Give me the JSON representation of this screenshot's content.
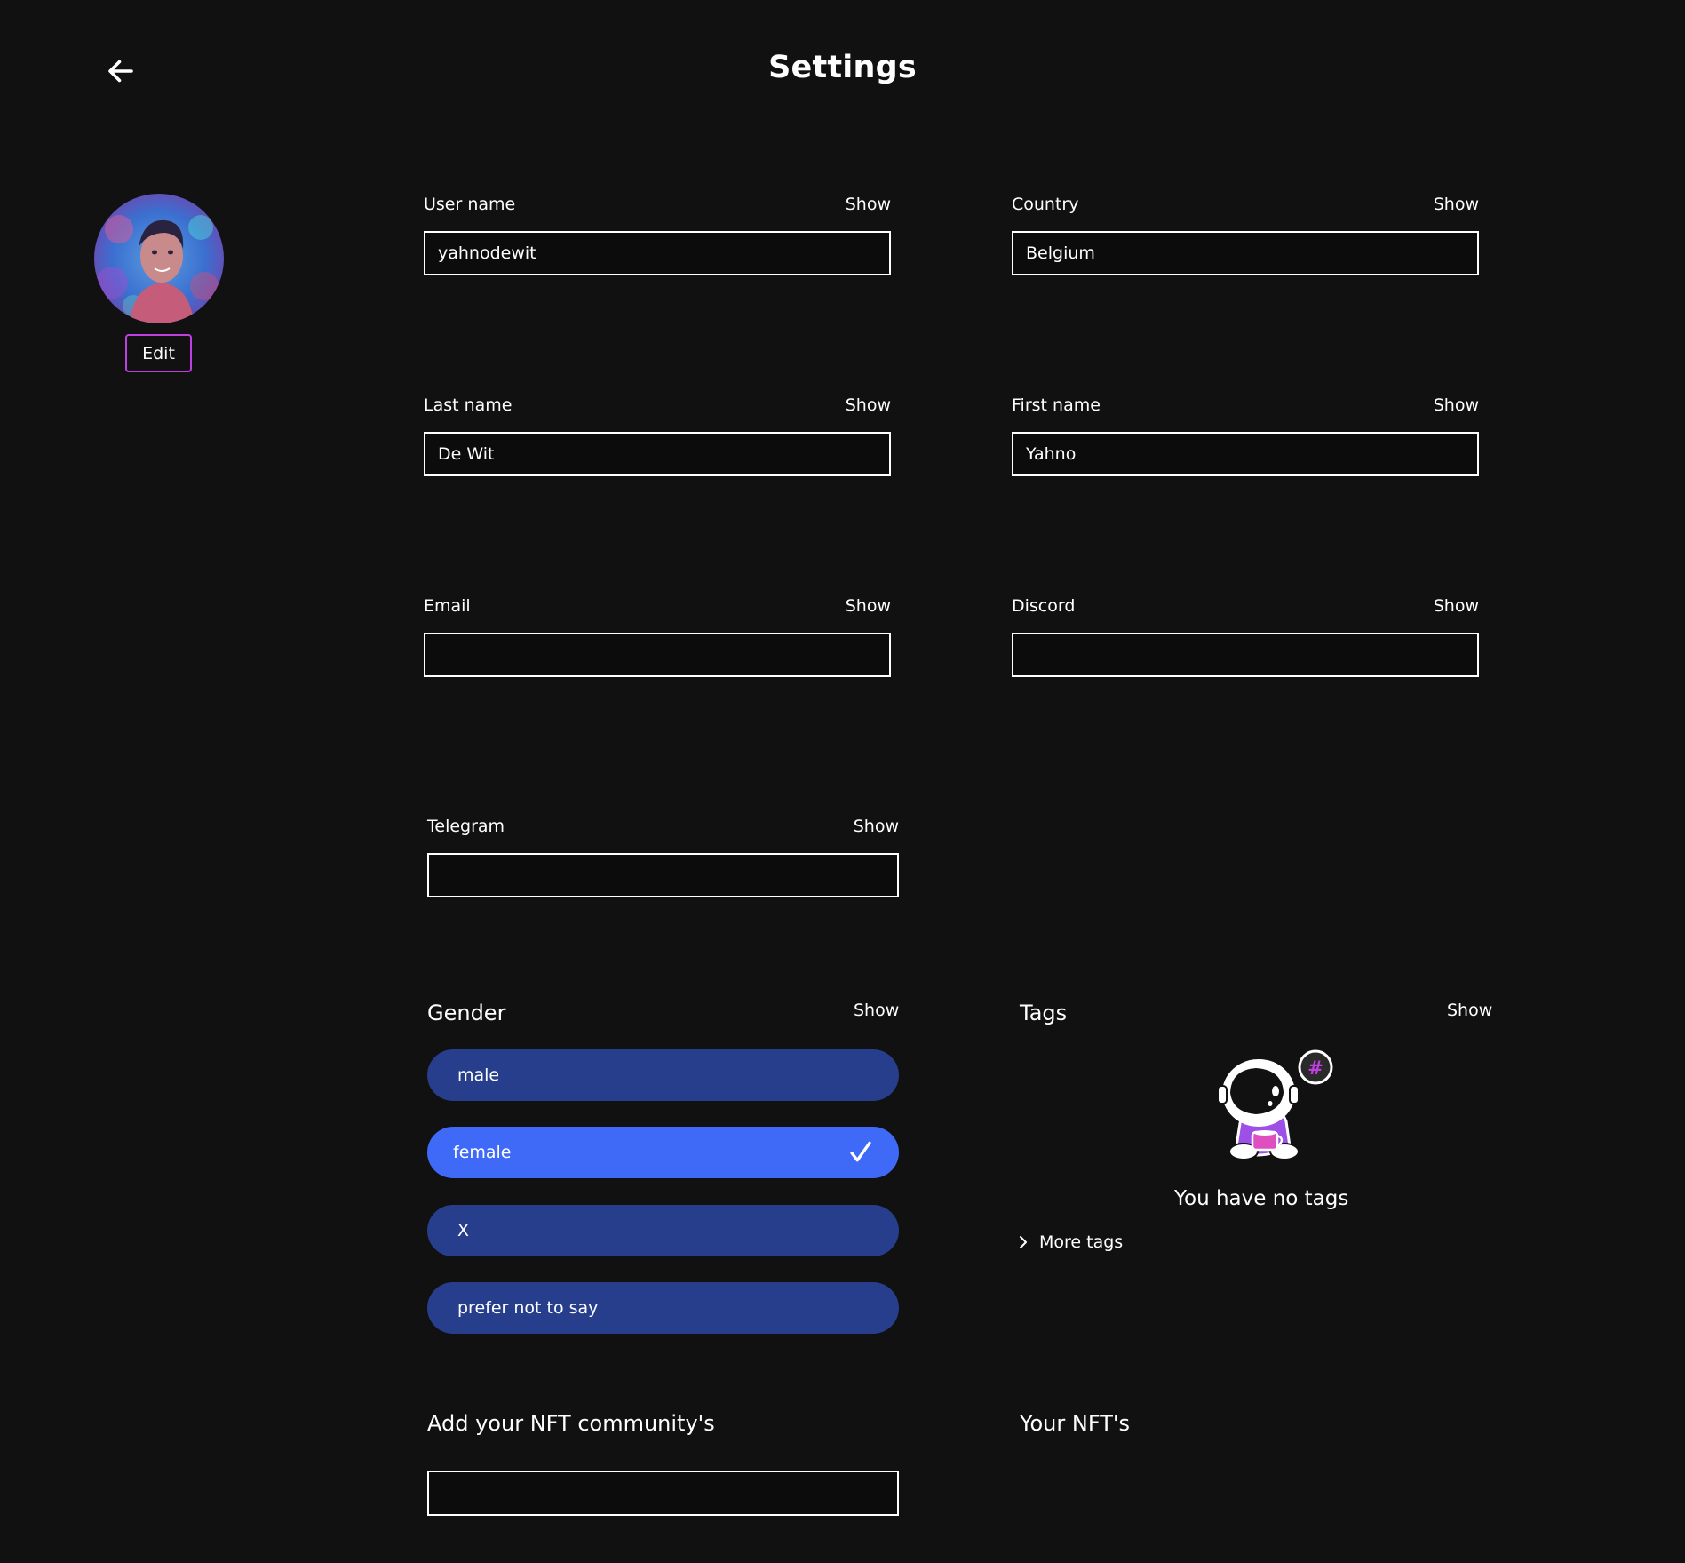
{
  "header": {
    "title": "Settings"
  },
  "profile": {
    "edit_label": "Edit"
  },
  "fields": {
    "username": {
      "label": "User name",
      "value": "yahnodewit",
      "show": "Show"
    },
    "country": {
      "label": "Country",
      "value": "Belgium",
      "show": "Show"
    },
    "lastname": {
      "label": "Last name",
      "value": "De Wit",
      "show": "Show"
    },
    "firstname": {
      "label": "First name",
      "value": "Yahno",
      "show": "Show"
    },
    "email": {
      "label": "Email",
      "value": "",
      "show": "Show"
    },
    "discord": {
      "label": "Discord",
      "value": "",
      "show": "Show"
    },
    "telegram": {
      "label": "Telegram",
      "value": "",
      "show": "Show"
    }
  },
  "gender": {
    "title": "Gender",
    "show": "Show",
    "options": [
      "male",
      "female",
      "X",
      "prefer not to say"
    ],
    "selected": "female"
  },
  "tags": {
    "title": "Tags",
    "show": "Show",
    "empty_text": "You have no tags",
    "more_label": "More tags"
  },
  "nft": {
    "community_title": "Add your NFT community's",
    "community_value": "",
    "yours_title": "Your NFT's"
  },
  "colors": {
    "background": "#111111",
    "accent_purple": "#c03fe0",
    "option_default": "#263e8c",
    "option_selected": "#3f69f7"
  },
  "icons": {
    "back": "arrow-left-icon",
    "check": "check-icon",
    "more": "chevron-right-icon"
  }
}
